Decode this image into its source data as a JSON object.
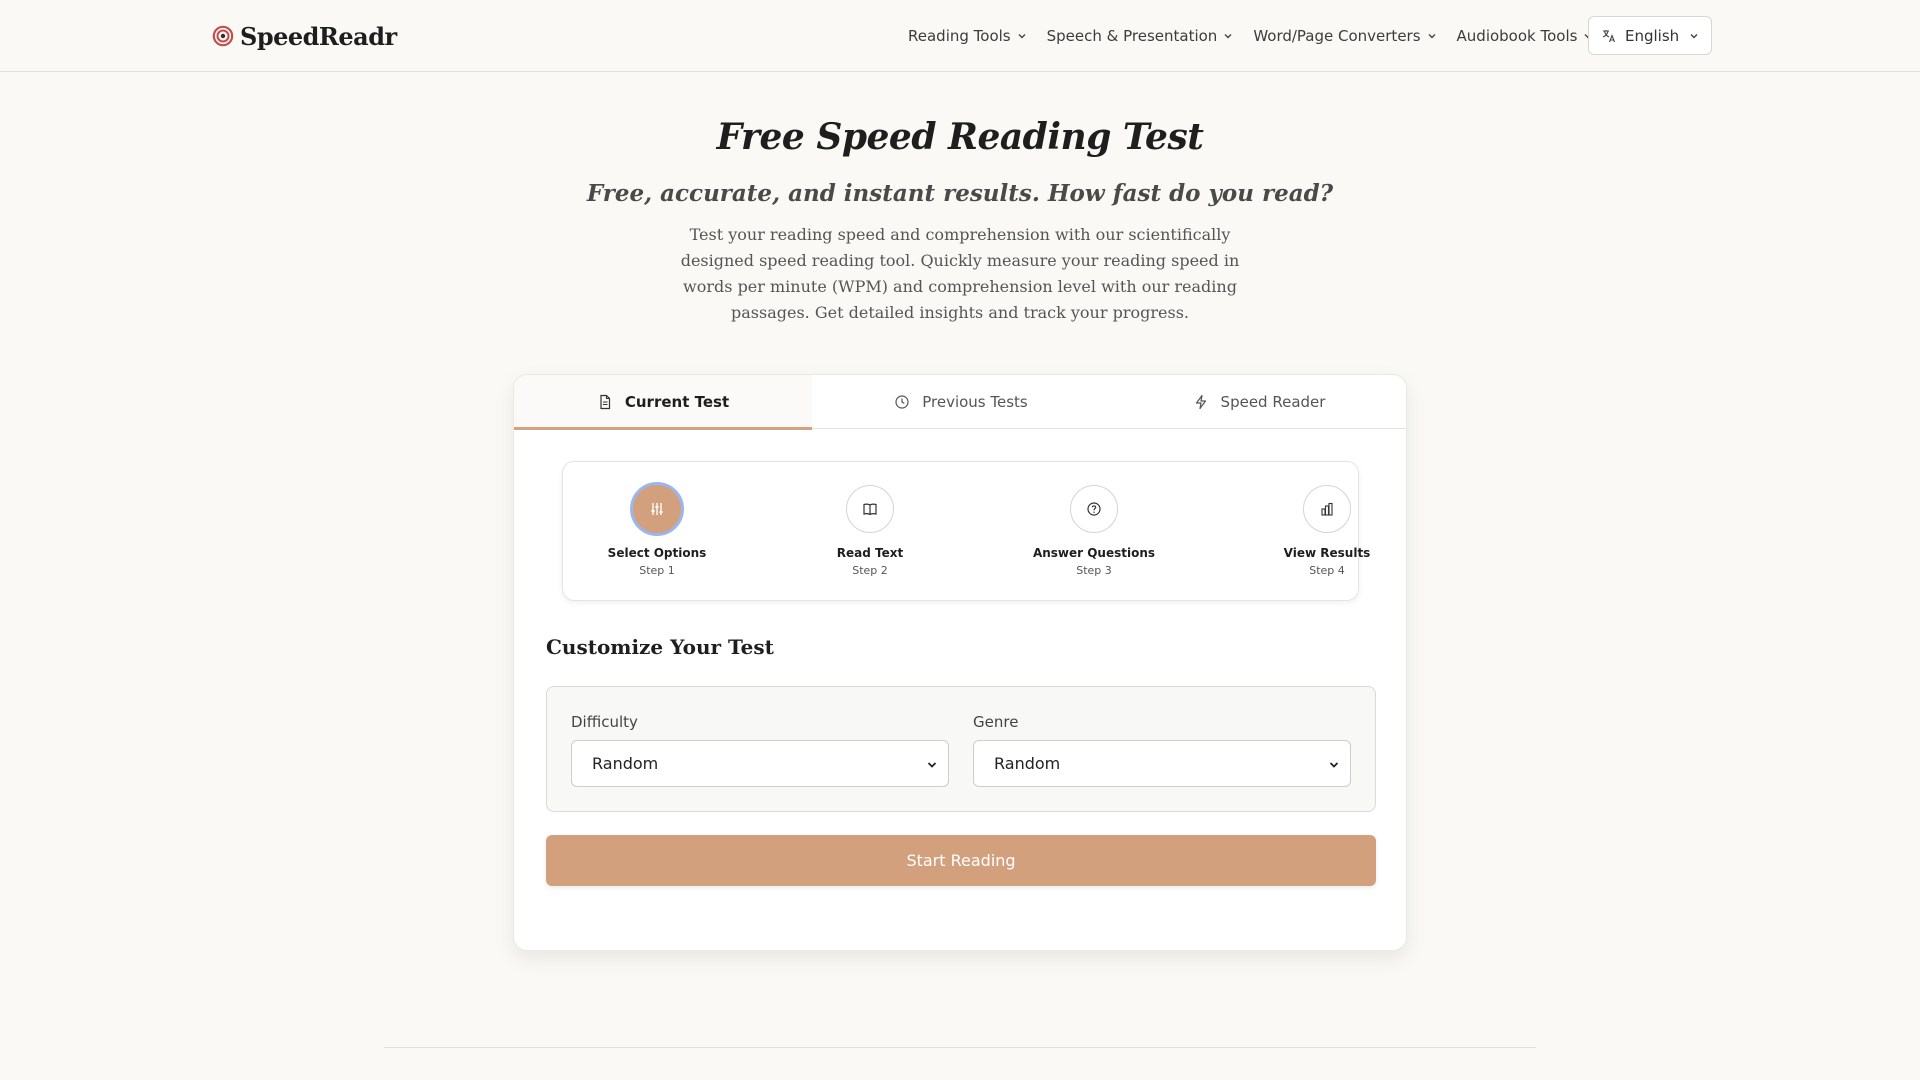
{
  "brand": {
    "name": "SpeedReadr"
  },
  "nav": {
    "items": [
      {
        "label": "Reading Tools"
      },
      {
        "label": "Speech & Presentation"
      },
      {
        "label": "Word/Page Converters"
      },
      {
        "label": "Audiobook Tools"
      }
    ],
    "language": "English"
  },
  "hero": {
    "title": "Free Speed Reading Test",
    "subtitle": "Free, accurate, and instant results. How fast do you read?",
    "description": "Test your reading speed and comprehension with our scientifically designed speed reading tool. Quickly measure your reading speed in words per minute (WPM) and comprehension level with our reading passages. Get detailed insights and track your progress."
  },
  "tabs": [
    {
      "label": "Current Test",
      "icon": "document-icon",
      "active": true
    },
    {
      "label": "Previous Tests",
      "icon": "clock-icon",
      "active": false
    },
    {
      "label": "Speed Reader",
      "icon": "lightning-icon",
      "active": false
    }
  ],
  "steps": [
    {
      "title": "Select Options",
      "sub": "Step 1",
      "icon": "sliders-icon",
      "active": true
    },
    {
      "title": "Read Text",
      "sub": "Step 2",
      "icon": "book-icon",
      "active": false
    },
    {
      "title": "Answer Questions",
      "sub": "Step 3",
      "icon": "question-icon",
      "active": false
    },
    {
      "title": "View Results",
      "sub": "Step 4",
      "icon": "bar-chart-icon",
      "active": false
    }
  ],
  "customize": {
    "title": "Customize Your Test",
    "difficulty": {
      "label": "Difficulty",
      "value": "Random"
    },
    "genre": {
      "label": "Genre",
      "value": "Random"
    },
    "start_label": "Start Reading"
  },
  "colors": {
    "accent": "#d3a07e",
    "background": "#faf9f6",
    "focus_ring": "#9ab6ee"
  }
}
